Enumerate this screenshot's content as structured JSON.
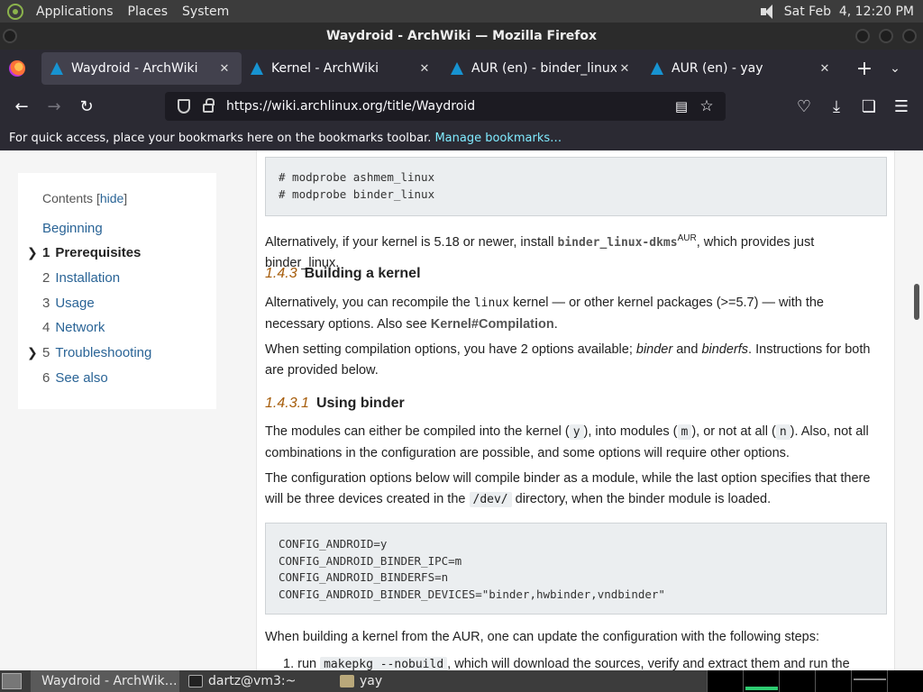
{
  "top_panel": {
    "menus": [
      "Applications",
      "Places",
      "System"
    ],
    "datetime": "Sat Feb  4, 12:20 PM"
  },
  "window": {
    "title": "Waydroid - ArchWiki — Mozilla Firefox"
  },
  "tabs": [
    {
      "label": "Waydroid - ArchWiki",
      "active": true
    },
    {
      "label": "Kernel - ArchWiki",
      "active": false
    },
    {
      "label": "AUR (en) - binder_linux-dkms",
      "active": false
    },
    {
      "label": "AUR (en) - yay",
      "active": false
    }
  ],
  "tab_close_glyph": "✕",
  "newtab_glyph": "+",
  "urlbar": {
    "url": "https://wiki.archlinux.org/title/Waydroid"
  },
  "bookmarks_bar": {
    "text": "For quick access, place your bookmarks here on the bookmarks toolbar.",
    "link": "Manage bookmarks…"
  },
  "toc": {
    "title": "Contents",
    "hide": "hide",
    "items": [
      {
        "num": "",
        "label": "Beginning"
      },
      {
        "num": "1",
        "label": "Prerequisites"
      },
      {
        "num": "2",
        "label": "Installation"
      },
      {
        "num": "3",
        "label": "Usage"
      },
      {
        "num": "4",
        "label": "Network"
      },
      {
        "num": "5",
        "label": "Troubleshooting"
      },
      {
        "num": "6",
        "label": "See also"
      }
    ]
  },
  "content": {
    "code1": [
      "# modprobe ashmem_linux",
      "# modprobe binder_linux"
    ],
    "p1": {
      "a": "Alternatively, if your kernel is 5.18 or newer, install ",
      "pkg": "binder_linux-dkms",
      "sup": "AUR",
      "b": ", which provides just binder_linux."
    },
    "h1": {
      "num": "1.4.3",
      "title": "Building a kernel"
    },
    "p2": {
      "a": "Alternatively, you can recompile the ",
      "code": "linux",
      "b": " kernel — or other kernel packages (>=5.7) — with the necessary options. Also see ",
      "link": "Kernel#Compilation",
      "c": "."
    },
    "p3": {
      "a": "When setting compilation options, you have 2 options available; ",
      "i1": "binder",
      "b": " and ",
      "i2": "binderfs",
      "c": ". Instructions for both are provided below."
    },
    "h2": {
      "num": "1.4.3.1",
      "title": "Using binder"
    },
    "p4": {
      "a": "The modules can either be compiled into the kernel (",
      "y": "y",
      "b": "), into modules (",
      "m": "m",
      "c": "), or not at all (",
      "n": "n",
      "d": "). Also, not all combinations in the configuration are possible, and some options will require other options."
    },
    "p5": {
      "a": "The configuration options below will compile binder as a module, while the last option specifies that there will be three devices created in the ",
      "code": "/dev/",
      "b": " directory, when the binder module is loaded."
    },
    "code2": [
      "CONFIG_ANDROID=y",
      "CONFIG_ANDROID_BINDER_IPC=m",
      "CONFIG_ANDROID_BINDERFS=n",
      "CONFIG_ANDROID_BINDER_DEVICES=\"binder,hwbinder,vndbinder\""
    ],
    "p6": "When building a kernel from the AUR, one can update the configuration with the following steps:",
    "li1": {
      "a": "1. run ",
      "code": "makepkg --nobuild",
      "b": ", which will download the sources, verify and extract them and run the"
    }
  },
  "taskbar": {
    "tasks": [
      "Waydroid - ArchWik…",
      "dartz@vm3:~",
      "yay"
    ]
  }
}
